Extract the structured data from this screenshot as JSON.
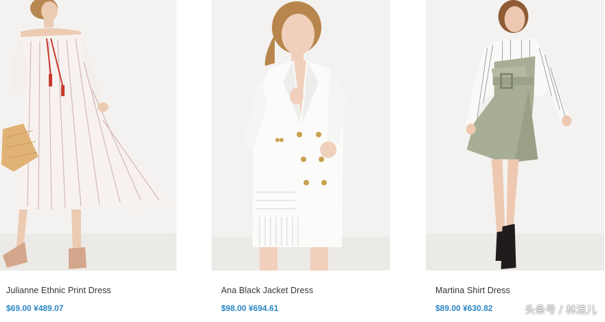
{
  "products": [
    {
      "name": "Julianne Ethnic Print Dress",
      "price": "$69.00 ¥489.07",
      "image_icon": "product-photo-icon"
    },
    {
      "name": "Ana Black Jacket Dress",
      "price": "$98.00 ¥694.61",
      "image_icon": "product-photo-icon"
    },
    {
      "name": "Martina Shirt Dress",
      "price": "$89.00 ¥630.82",
      "image_icon": "product-photo-icon"
    }
  ],
  "watermark": "头条号 / 林洁儿",
  "colors": {
    "price": "#2b86c4",
    "name": "#333333",
    "photo_bg": "#f3f2f0"
  }
}
